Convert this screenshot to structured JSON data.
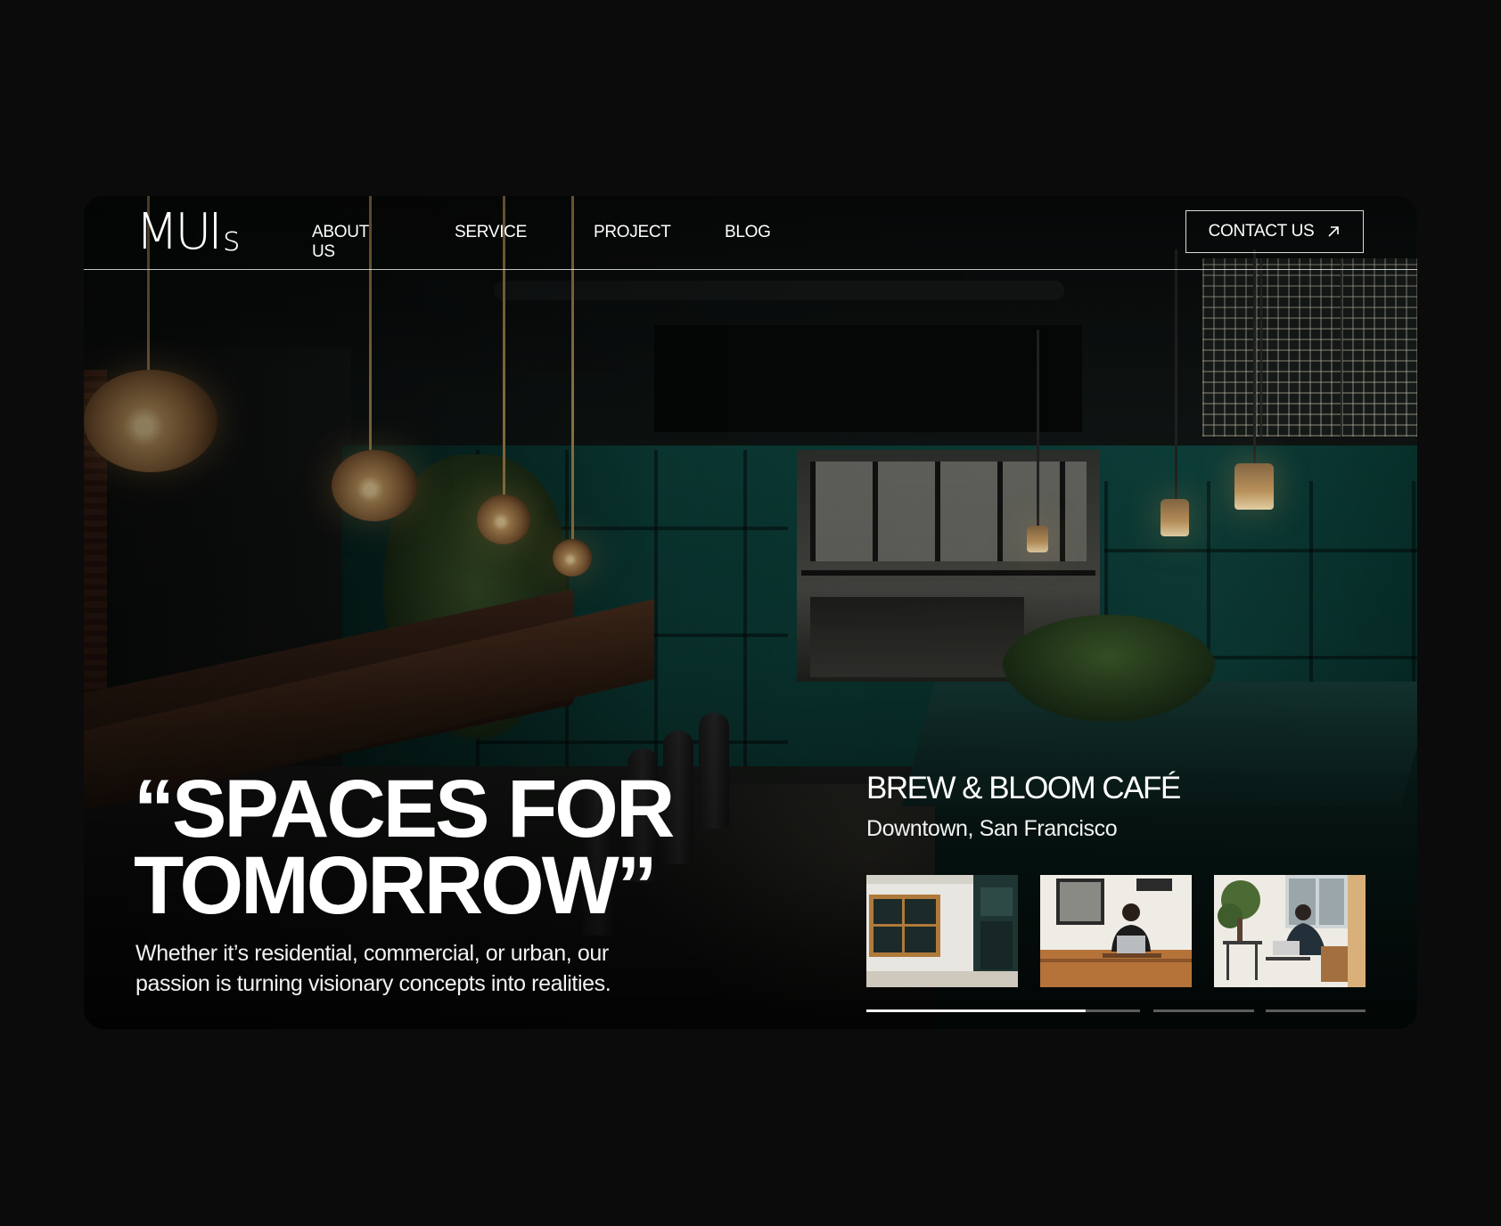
{
  "brand": {
    "logo_main": "MUI",
    "logo_sub": "s"
  },
  "nav": {
    "items": [
      "ABOUT US",
      "SERVICE",
      "PROJECT",
      "BLOG"
    ],
    "contact_label": "CONTACT US",
    "contact_icon": "arrow-up-right-icon"
  },
  "hero": {
    "headline_line1": "“SPACES FOR",
    "headline_line2": "TOMORROW”",
    "subtext": "Whether it’s residential, commercial, or urban, our passion is turning visionary concepts into realities."
  },
  "project": {
    "title": "BREW & BLOOM CAFÉ",
    "location": "Downtown, San Francisco",
    "thumbnails": [
      "cafe-exterior-thumb",
      "woman-laptop-thumb",
      "man-laptop-thumb"
    ],
    "progress": [
      {
        "fill": 0.8
      },
      {
        "fill": 0
      },
      {
        "fill": 0
      }
    ]
  },
  "colors": {
    "page_bg": "#0b0b0b",
    "text": "#ffffff",
    "teal_wall": "#0b3d37"
  }
}
